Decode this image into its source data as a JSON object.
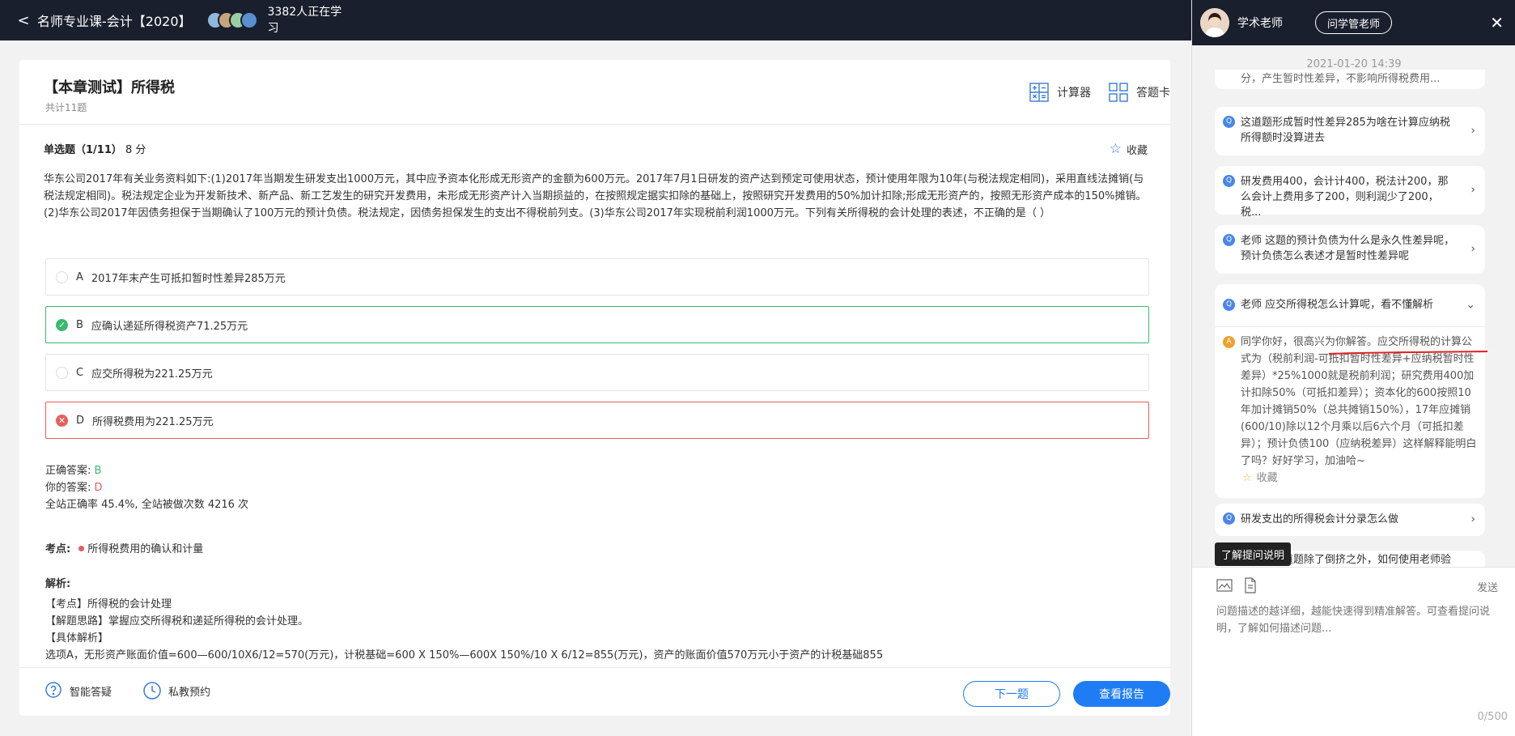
{
  "topbar": {
    "back": "<",
    "title": "名师专业课-会计【2020】",
    "learning": "3382人正在学习"
  },
  "test": {
    "title": "【本章测试】所得税",
    "count": "共计11题",
    "calculator": "计算器",
    "answer_card": "答题卡"
  },
  "question": {
    "type": "单选题（1/11）",
    "score": "8 分",
    "favorite": "收藏",
    "text": "华东公司2017年有关业务资料如下:(1)2017年当期发生研发支出1000万元，其中应予资本化形成无形资产的金额为600万元。2017年7月1日研发的资产达到预定可使用状态，预计使用年限为10年(与税法规定相同)，采用直线法摊销(与税法规定相同)。税法规定企业为开发新技术、新产品、新工艺发生的研究开发费用，未形成无形资产计入当期损益的，在按照规定据实扣除的基础上，按照研究开发费用的50%加计扣除;形成无形资产的，按照无形资产成本的150%摊销。(2)华东公司2017年因债务担保于当期确认了100万元的预计负债。税法规定，因债务担保发生的支出不得税前列支。(3)华东公司2017年实现税前利润1000万元。下列有关所得税的会计处理的表述，不正确的是（ ）",
    "options": [
      {
        "letter": "A",
        "text": "2017年末产生可抵扣暂时性差异285万元"
      },
      {
        "letter": "B",
        "text": "应确认递延所得税资产71.25万元"
      },
      {
        "letter": "C",
        "text": "应交所得税为221.25万元"
      },
      {
        "letter": "D",
        "text": "所得税费用为221.25万元"
      }
    ],
    "correct_label": "正确答案:",
    "correct_value": "B",
    "yours_label": "你的答案:",
    "yours_value": "D",
    "stats": "全站正确率 45.4%, 全站被做次数 4216 次",
    "topic_label": "考点:",
    "topic_value": "所得税费用的确认和计量",
    "analysis_label": "解析:",
    "analysis_lines": [
      "【考点】所得税的会计处理",
      "【解题思路】掌握应交所得税和递延所得税的会计处理。",
      "【具体解析】",
      "选项A，无形资产账面价值=600—600/10X6/12=570(万元)，计税基础=600 X 150%—600X 150%/10 X 6/12=855(万元)，资产的账面价值570万元小于资产的计税基础855"
    ]
  },
  "footer": {
    "smart_qa": "智能答疑",
    "private_booking": "私教预约",
    "next": "下一题",
    "report": "查看报告"
  },
  "panel": {
    "teacher": "学术老师",
    "ask_button": "问学管老师",
    "close": "✕",
    "time": "2021-01-20 14:39",
    "partial_top": "分，产生暂时性差异，不影响所得税费用...",
    "questions": [
      "这道题形成暂时性差异285为啥在计算应纳税所得额时没算进去",
      "研发费用400，会计计400，税法计200，那么会计上费用多了200，则利润少了200，税...",
      "老师 这题的预计负债为什么是永久性差异呢，预计负债怎么表述才是暂时性差异呢",
      "老师 应交所得税怎么计算呢，看不懂解析",
      "研发支出的所得税会计分录怎么做",
      "老师，这道题除了倒挤之外，如何使用老师验算"
    ],
    "answer": "同学你好，很高兴为你解答。应交所得税的计算公式为（税前利润-可抵扣暂时性差异+应纳税暂时性差异）*25%1000就是税前利润；研究费用400加计扣除50%（可抵扣差异）；资本化的600按照10年加计摊销50%（总共摊销150%），17年应摊销(600/10)除以12个月乘以后6六个月（可抵扣差异）；预计负债100（应纳税差异）这样解释能明白了吗？好好学习，加油哈~",
    "answer_fav": "收藏",
    "tooltip": "了解提问说明",
    "send": "发送",
    "placeholder": "问题描述的越详细，越能快速得到精准解答。可查看提问说明，了解如何描述问题...",
    "counter": "0/500"
  }
}
